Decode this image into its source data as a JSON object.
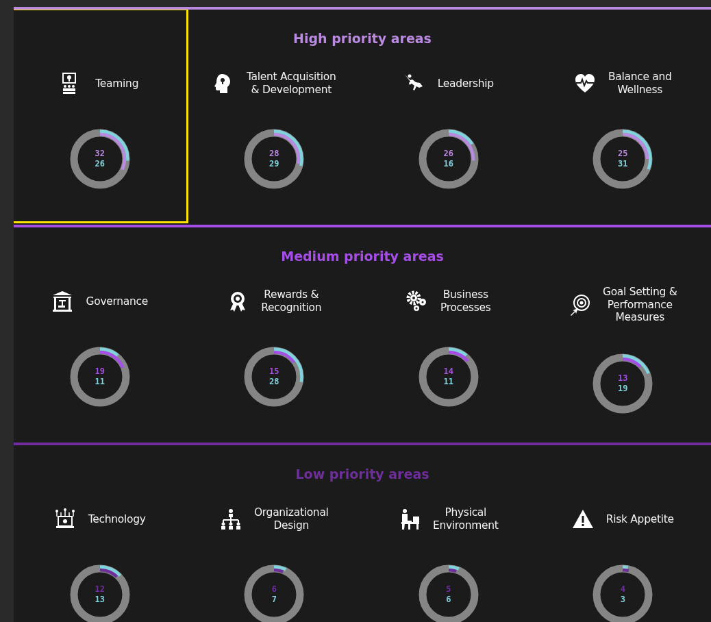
{
  "sections": [
    {
      "title": "High priority areas",
      "color": "#b98ae0",
      "areas": [
        {
          "label": "Teaming",
          "selected": true,
          "rings": [
            {
              "value": "32",
              "level": 0.32,
              "color": "#b98ae0"
            },
            {
              "value": "26",
              "level": 0.26,
              "color": "#80d2dc"
            }
          ]
        },
        {
          "label": "Talent Acquisition\n& Development",
          "selected": false,
          "rings": [
            {
              "value": "28",
              "level": 0.28,
              "color": "#b98ae0"
            },
            {
              "value": "29",
              "level": 0.29,
              "color": "#80d2dc"
            }
          ]
        },
        {
          "label": "Leadership",
          "selected": false,
          "rings": [
            {
              "value": "26",
              "level": 0.26,
              "color": "#b98ae0"
            },
            {
              "value": "16",
              "level": 0.16,
              "color": "#80d2dc"
            }
          ]
        },
        {
          "label": "Balance and\nWellness",
          "selected": false,
          "rings": [
            {
              "value": "25",
              "level": 0.25,
              "color": "#b98ae0"
            },
            {
              "value": "31",
              "level": 0.31,
              "color": "#80d2dc"
            }
          ]
        }
      ]
    },
    {
      "title": "Medium priority areas",
      "color": "#a64ee8",
      "areas": [
        {
          "label": "Governance",
          "selected": false,
          "rings": [
            {
              "value": "19",
              "level": 0.19,
              "color": "#a64ee8"
            },
            {
              "value": "11",
              "level": 0.11,
              "color": "#80d2dc"
            }
          ]
        },
        {
          "label": "Rewards &\nRecognition",
          "selected": false,
          "rings": [
            {
              "value": "15",
              "level": 0.15,
              "color": "#a64ee8"
            },
            {
              "value": "28",
              "level": 0.28,
              "color": "#80d2dc"
            }
          ]
        },
        {
          "label": "Business\nProcesses",
          "selected": false,
          "rings": [
            {
              "value": "14",
              "level": 0.14,
              "color": "#a64ee8"
            },
            {
              "value": "11",
              "level": 0.11,
              "color": "#80d2dc"
            }
          ]
        },
        {
          "label": "Goal Setting &\nPerformance\nMeasures",
          "selected": false,
          "rings": [
            {
              "value": "13",
              "level": 0.13,
              "color": "#a64ee8"
            },
            {
              "value": "19",
              "level": 0.19,
              "color": "#80d2dc"
            }
          ]
        }
      ]
    },
    {
      "title": "Low priority areas",
      "color": "#6e2f9c",
      "areas": [
        {
          "label": "Technology",
          "selected": false,
          "rings": [
            {
              "value": "12",
              "level": 0.12,
              "color": "#6e2f9c"
            },
            {
              "value": "13",
              "level": 0.13,
              "color": "#80d2dc"
            }
          ]
        },
        {
          "label": "Organizational\nDesign",
          "selected": false,
          "rings": [
            {
              "value": "6",
              "level": 0.06,
              "color": "#6e2f9c"
            },
            {
              "value": "7",
              "level": 0.07,
              "color": "#80d2dc"
            }
          ]
        },
        {
          "label": "Physical\nEnvironment",
          "selected": false,
          "rings": [
            {
              "value": "5",
              "level": 0.05,
              "color": "#6e2f9c"
            },
            {
              "value": "6",
              "level": 0.06,
              "color": "#80d2dc"
            }
          ]
        },
        {
          "label": "Risk Appetite",
          "selected": false,
          "rings": [
            {
              "value": "4",
              "level": 0.04,
              "color": "#6e2f9c"
            },
            {
              "value": "3",
              "level": 0.03,
              "color": "#80d2dc"
            }
          ]
        }
      ]
    }
  ]
}
